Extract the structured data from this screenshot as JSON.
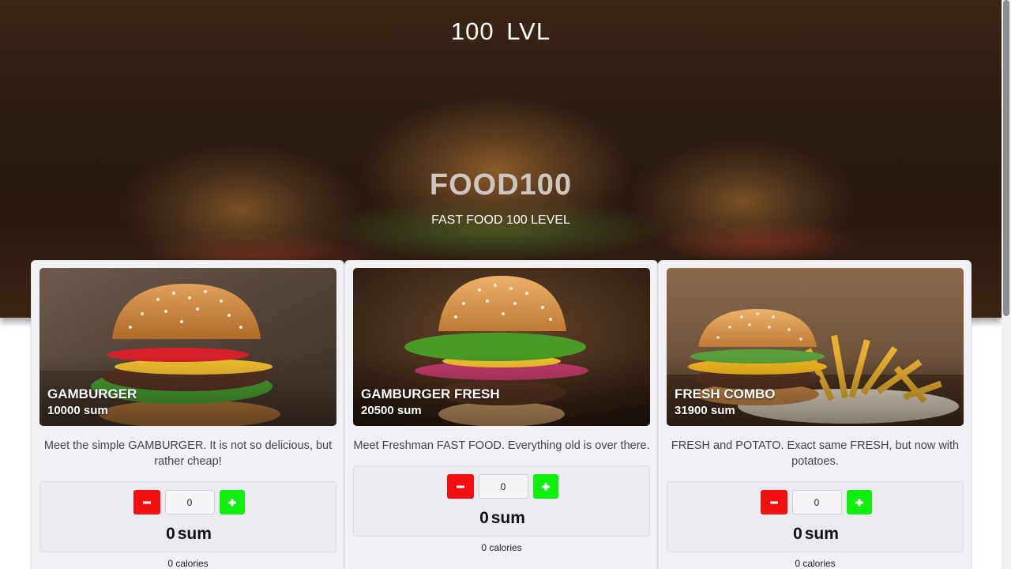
{
  "header": {
    "brand": "100 LVL",
    "title": "FOOD100",
    "subtitle": "FAST FOOD 100 LEVEL"
  },
  "products": [
    {
      "name": "GAMBURGER",
      "price": "10000 sum",
      "description": "Meet the simple GAMBURGER. It is not so delicious, but rather cheap!",
      "quantity": "0",
      "total_value": "0",
      "total_unit": "sum",
      "calories": "0 calories"
    },
    {
      "name": "GAMBURGER FRESH",
      "price": "20500 sum",
      "description": "Meet Freshman FAST FOOD. Everything old is over there.",
      "quantity": "0",
      "total_value": "0",
      "total_unit": "sum",
      "calories": "0 calories"
    },
    {
      "name": "FRESH COMBO",
      "price": "31900 sum",
      "description": "FRESH and POTATO. Exact same FRESH, but now with potatoes.",
      "quantity": "0",
      "total_value": "0",
      "total_unit": "sum",
      "calories": "0 calories"
    }
  ],
  "icons": {
    "minus": "minus-icon",
    "plus": "plus-icon"
  },
  "colors": {
    "minus_button": "#f10f0f",
    "plus_button": "#0ff00f",
    "card_background": "#f0f0f5"
  }
}
